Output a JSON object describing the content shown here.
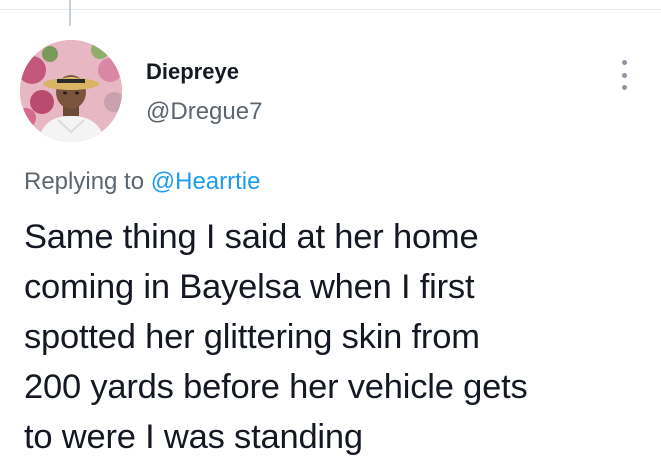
{
  "author": {
    "display_name": "Diepreye",
    "handle": "@Dregue7",
    "avatar_icon": "profile-photo-man-in-straw-hat"
  },
  "reply": {
    "prefix": "Replying to",
    "handle": "@Hearrtie"
  },
  "tweet": {
    "lines": [
      "Same thing I said at her home",
      "coming in Bayelsa when I first",
      "spotted her glittering skin from",
      "200 yards before her vehicle gets",
      "to were I was standing"
    ]
  },
  "menu": {
    "icon": "more-vertical-icon"
  },
  "colors": {
    "link": "#1d9bf0",
    "secondary_text": "#5b6670",
    "primary_text": "#141823",
    "divider": "#e6ecf0"
  }
}
